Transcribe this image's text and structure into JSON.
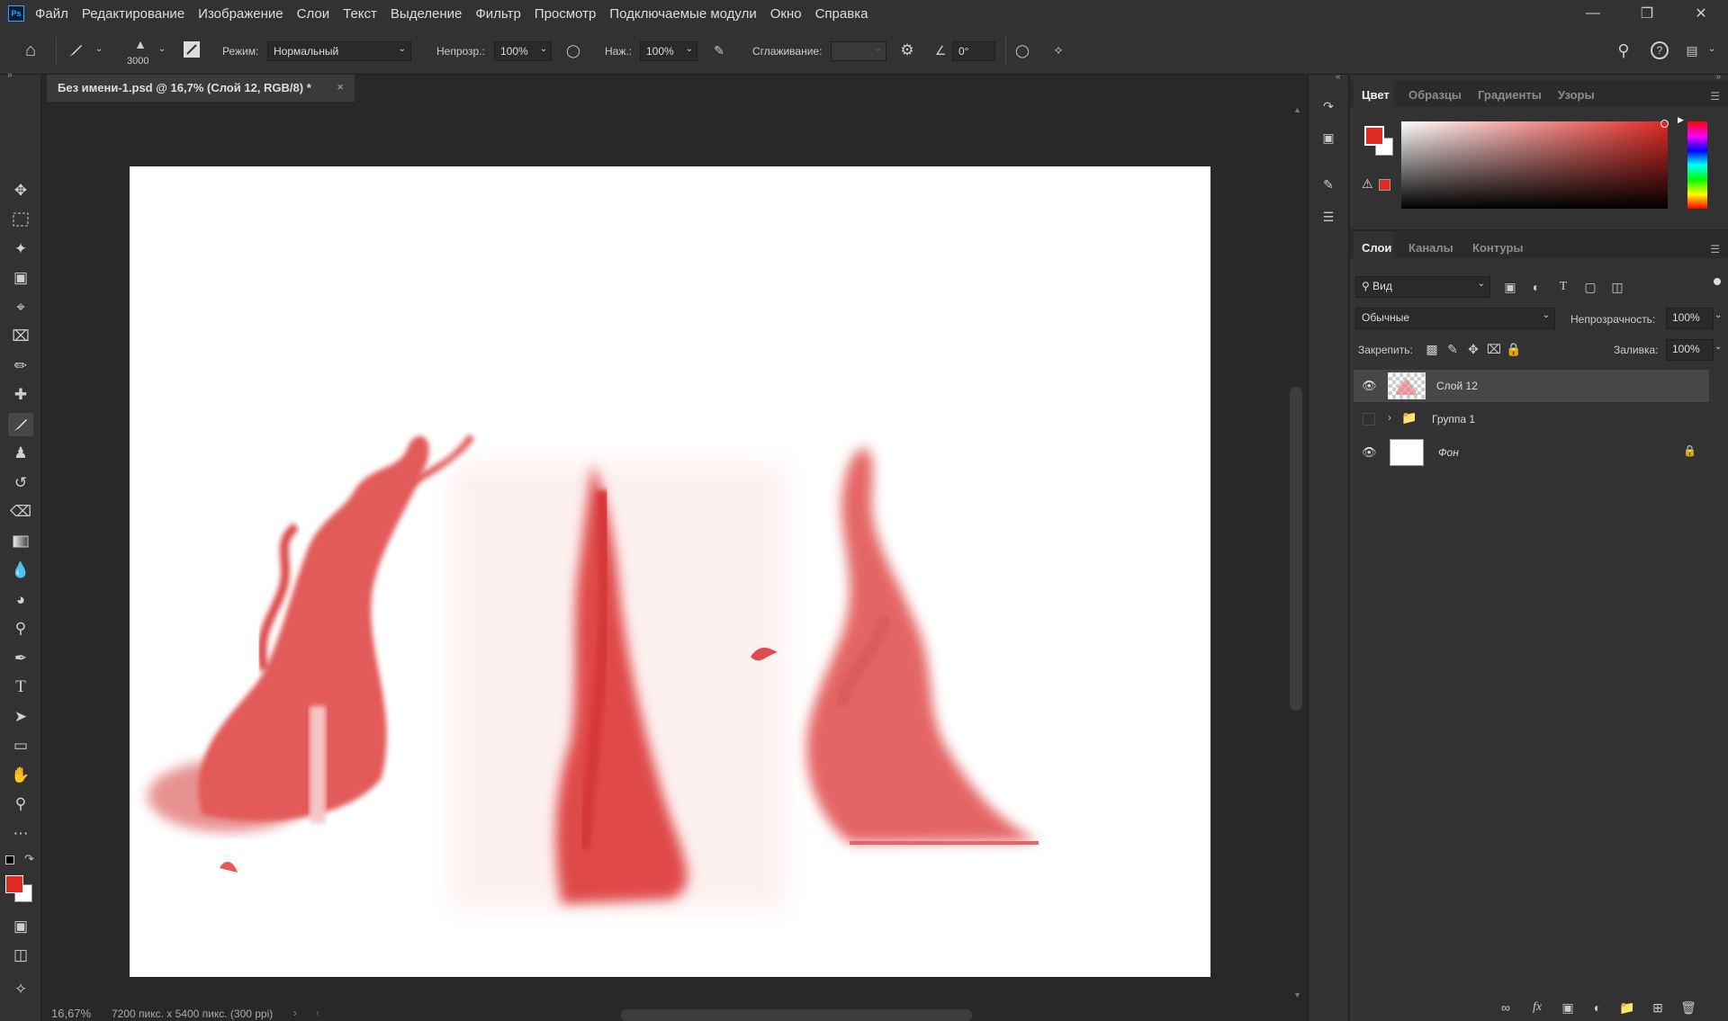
{
  "app": {
    "logo": "Ps"
  },
  "menu": [
    "Файл",
    "Редактирование",
    "Изображение",
    "Слои",
    "Текст",
    "Выделение",
    "Фильтр",
    "Просмотр",
    "Подключаемые модули",
    "Окно",
    "Справка"
  ],
  "options": {
    "brush_size": "3000",
    "mode_label": "Режим:",
    "mode_value": "Нормальный",
    "opacity_label": "Непрозр.:",
    "opacity_value": "100%",
    "pressure_label": "Наж.:",
    "pressure_value": "100%",
    "smoothing_label": "Сглаживание:",
    "angle_value": "0°"
  },
  "document": {
    "tab_title": "Без имени-1.psd @ 16,7% (Слой 12, RGB/8) *",
    "close": "×"
  },
  "status": {
    "zoom": "16,67%",
    "info": "7200 пикс. x 5400 пикс. (300 ppi)"
  },
  "color_panel": {
    "tabs": [
      "Цвет",
      "Образцы",
      "Градиенты",
      "Узоры"
    ],
    "foreground": "#e02a24",
    "background": "#ffffff"
  },
  "layers_panel": {
    "tabs": [
      "Слои",
      "Каналы",
      "Контуры"
    ],
    "filter_value": "Вид",
    "blend_mode": "Обычные",
    "opacity_label": "Непрозрачность:",
    "opacity_value": "100%",
    "lock_label": "Закрепить:",
    "fill_label": "Заливка:",
    "fill_value": "100%",
    "layers": [
      {
        "name": "Слой 12"
      },
      {
        "name": "Группа 1"
      },
      {
        "name": "Фон"
      }
    ]
  },
  "icons": {
    "fx": "fx"
  }
}
